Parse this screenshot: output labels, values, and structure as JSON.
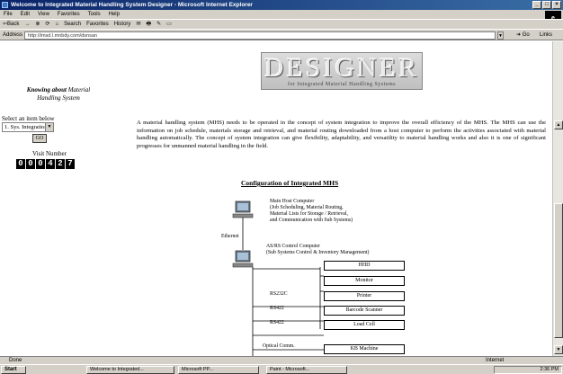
{
  "window": {
    "title": "Welcome to Integrated Material Handling System Designer - Microsoft Internet Explorer",
    "buttons": [
      "_",
      "□",
      "×"
    ]
  },
  "menu": [
    "File",
    "Edit",
    "View",
    "Favorites",
    "Tools",
    "Help"
  ],
  "toolbar": [
    "⇦Back",
    "→",
    "⊗",
    "⟳",
    "⌂",
    "Search",
    "Favorites",
    "History",
    "✉",
    "🖶",
    "✎",
    "▭"
  ],
  "address": {
    "label": "Address",
    "value": "http://imsd.l.mnbdy.com/dsnsan",
    "go": "Go",
    "links": "Links"
  },
  "logo": {
    "title": "DESIGNER",
    "subtitle": "for Integrated Material Handling Systems"
  },
  "sidebar": {
    "knowing_line1": "Knowing about",
    "knowing_line1_tail": "Material",
    "knowing_line2": "Handling System",
    "select_label": "Select an item below",
    "select_value": "1. Sys. Integration",
    "go_label": "GO",
    "visit_label": "Visit Number",
    "visit_digits": [
      "0",
      "0",
      "0",
      "4",
      "2",
      "7"
    ]
  },
  "main": {
    "paragraph": "A material handling system (MHS) needs to be operated in the concept of system integration to improve the overall efficiency of the MHS. The MHS can use the information on job schedule, materials storage and retrieval, and material routing downloaded from a host computer to perform the activities associated with material handling automatically. The concept of system integration can give flexibility, adaptability, and versatility to material handling works and also it is one of significant progresses for unmanned material handling in the field."
  },
  "diagram": {
    "title": "Configuration of Integrated MHS",
    "host": [
      "Main Host Computer",
      "(Job Scheduling, Material Routing,",
      "Material Lists for Storage / Retrieval,",
      "and Communication with Sub Systems)"
    ],
    "ethernet": "Ethernet",
    "control": [
      "AS/RS Control Computer",
      "(Sub Systems Control & Inventory Management)"
    ],
    "boxes": [
      "HHD",
      "Monitor",
      "Printer",
      "Barcode Scanner",
      "Load Cell",
      "KB Machine"
    ],
    "links": [
      "RS232C",
      "RS422",
      "RS422",
      "Optical Comm."
    ]
  },
  "status": {
    "left": "Done",
    "zone": "Internet"
  },
  "taskbar": {
    "start": "Start",
    "items": [
      "Welcome to Integrated...",
      "Microsoft PP...",
      "Paint - Microsoft..."
    ],
    "clock": "2:36 PM"
  }
}
